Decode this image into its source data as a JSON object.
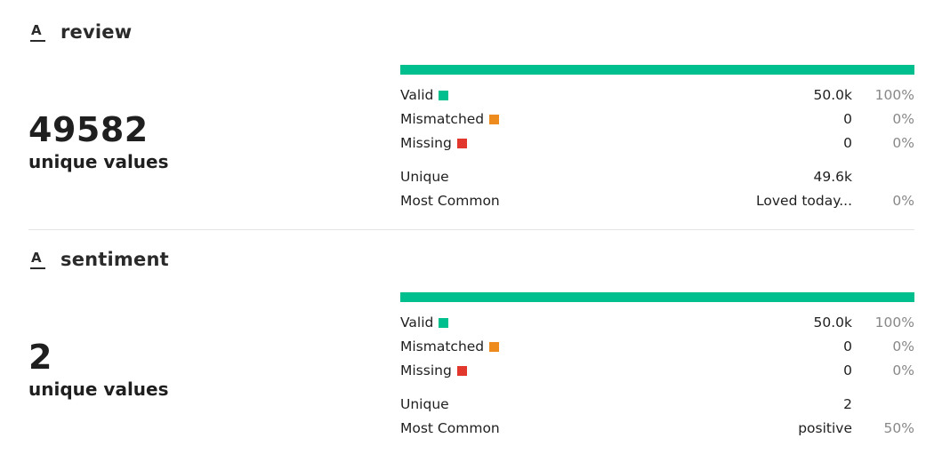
{
  "colors": {
    "valid": "#00bf8f",
    "mismatched": "#ee8b1f",
    "missing": "#e2372d",
    "bar_track": "#e6e6e6"
  },
  "columns": [
    {
      "type_icon": "string-type-icon",
      "type_glyph": "A",
      "name": "review",
      "unique_count": "49582",
      "unique_label": "unique values",
      "valid_fraction": 1.0,
      "stats": {
        "valid": {
          "label": "Valid",
          "value": "50.0k",
          "pct": "100%"
        },
        "mismatched": {
          "label": "Mismatched",
          "value": "0",
          "pct": "0%"
        },
        "missing": {
          "label": "Missing",
          "value": "0",
          "pct": "0%"
        },
        "unique": {
          "label": "Unique",
          "value": "49.6k"
        },
        "most_common": {
          "label": "Most Common",
          "value": "Loved today...",
          "pct": "0%"
        }
      }
    },
    {
      "type_icon": "string-type-icon",
      "type_glyph": "A",
      "name": "sentiment",
      "unique_count": "2",
      "unique_label": "unique values",
      "valid_fraction": 1.0,
      "stats": {
        "valid": {
          "label": "Valid",
          "value": "50.0k",
          "pct": "100%"
        },
        "mismatched": {
          "label": "Mismatched",
          "value": "0",
          "pct": "0%"
        },
        "missing": {
          "label": "Missing",
          "value": "0",
          "pct": "0%"
        },
        "unique": {
          "label": "Unique",
          "value": "2"
        },
        "most_common": {
          "label": "Most Common",
          "value": "positive",
          "pct": "50%"
        }
      }
    }
  ]
}
